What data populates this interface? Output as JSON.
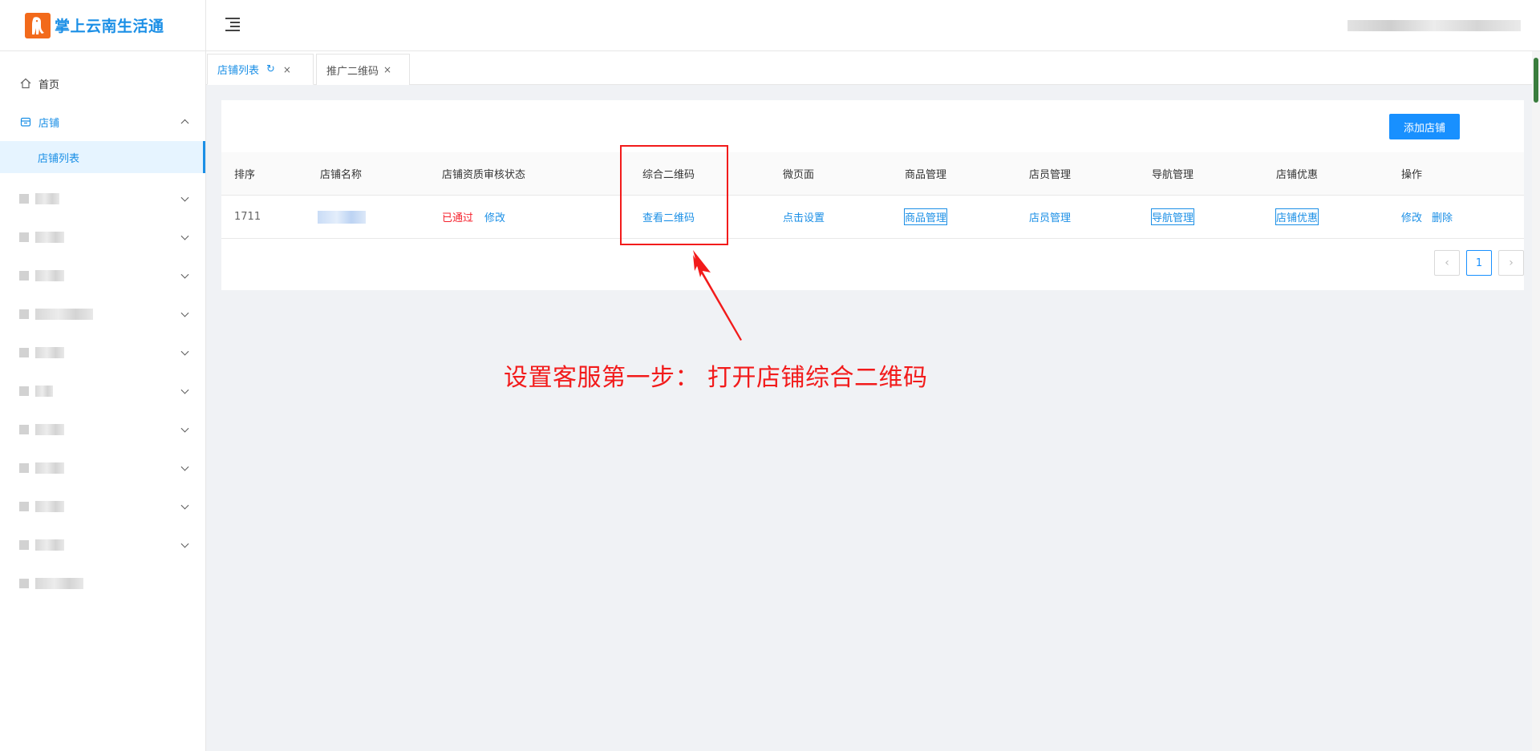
{
  "app": {
    "title": "掌上云南生活通",
    "logo_glyph": "↑"
  },
  "sidebar": {
    "home_label": "首页",
    "store_label": "店铺",
    "store_sub_label": "店铺列表"
  },
  "tabs": [
    {
      "label": "店铺列表",
      "refresh_glyph": "↻",
      "close_glyph": "×"
    },
    {
      "label": "推广二维码",
      "close_glyph": "×"
    }
  ],
  "toolbar": {
    "add_store_label": "添加店铺"
  },
  "table": {
    "headers": [
      "排序",
      "店铺名称",
      "店铺资质审核状态",
      "综合二维码",
      "微页面",
      "商品管理",
      "店员管理",
      "导航管理",
      "店铺优惠",
      "操作"
    ],
    "row": {
      "order": "1711",
      "status": "已通过",
      "status_edit": "修改",
      "qrcode": "查看二维码",
      "micro_page": "点击设置",
      "goods": "商品管理",
      "staff": "店员管理",
      "nav": "导航管理",
      "discount": "店铺优惠",
      "op_edit": "修改",
      "op_delete": "删除"
    }
  },
  "pagination": {
    "prev_glyph": "‹",
    "current": "1",
    "next_glyph": "›"
  },
  "annotation": {
    "text": "设置客服第一步： 打开店铺综合二维码"
  },
  "colors": {
    "accent": "#1890ff",
    "annotation": "#f21b1b",
    "logo": "#f26a1b"
  }
}
